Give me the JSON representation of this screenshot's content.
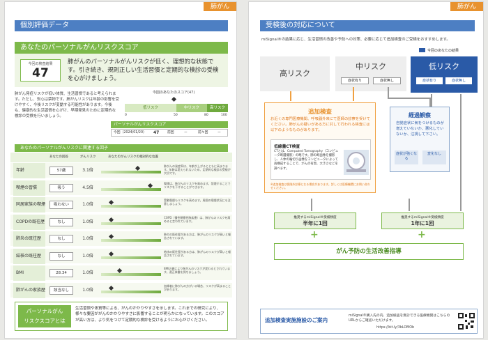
{
  "left": {
    "tab": "肺がん",
    "header": "個別評価データ",
    "score_section_title": "あなたのパーソナルがんリスクスコア",
    "score_label": "今回の検査結果",
    "score_value": "47",
    "score_message": "肺がんのパーソナルがんリスクが低く、理想的な状態です。引き続き、規則正しい生活習慣と定期的な検診の受検を心がけましょう。",
    "intro_text": "肺がん発症リスクが低い体質、生活習慣であると考えられます。ただし、安心は禁物です。肺がんリスクは年齢の影響を受けやすく、今後リスクが変動する可能性があります。今後も、健康的な生活習慣を心がけ、早期発見のために定期的な検診の受検を行いましょう。",
    "scale": {
      "caption": "今回のあなたのスコア(47)",
      "zones": [
        "低リスク",
        "中リスク",
        "高リスク"
      ],
      "ticks": [
        "0",
        "50",
        "80",
        "100"
      ],
      "score": 47
    },
    "history": {
      "title": "パーソナルがんリスクスコア",
      "now_label": "今回（2024/01/20）",
      "now_value": "47",
      "prev1_label": "前回",
      "prev1_value": "ー",
      "prev2_label": "前々回",
      "prev2_value": "ー"
    },
    "factors": {
      "title": "あなたのパーソナルがんリスクに関連する因子",
      "col_result": "あなたの回答",
      "col_mult": "がんリスク",
      "col_graph": "あなたのがんリスクの相対的な位置",
      "rows": [
        {
          "label": "年齢",
          "value": "57歳",
          "mult": "3.1倍",
          "pos": 0.62,
          "note": "肺がんの発症率は、年齢が上がるとともに高まります。年齢は変えられないため、定期的な検診の受検が大切です。"
        },
        {
          "label": "喫煙の習慣",
          "value": "吸う",
          "mult": "4.5倍",
          "pos": 0.85,
          "note": "喫煙は、肺がんのリスクを高めます。禁煙することでリスクを下げることができます。"
        },
        {
          "label": "同居家族の喫煙",
          "value": "吸わない",
          "mult": "1.0倍",
          "pos": 0.15,
          "note": "受動喫煙もリスクを高めます。周囲の喫煙状況にも注意しましょう。"
        },
        {
          "label": "COPDの既往歴",
          "value": "なし",
          "mult": "1.0倍",
          "pos": 0.15,
          "note": "COPD（慢性閉塞性肺疾患）は、肺がんのリスクを高めると言われています。"
        },
        {
          "label": "肺炎の既往歴",
          "value": "なし",
          "mult": "1.0倍",
          "pos": 0.15,
          "note": "肺炎の既往歴がある方は、肺がんのリスクが高いと報告されています。"
        },
        {
          "label": "結核の既往歴",
          "value": "なし",
          "mult": "1.0倍",
          "pos": 0.15,
          "note": "結核の既往歴がある方は、肺がんのリスクが高いと報告されています。"
        },
        {
          "label": "BMI",
          "value": "28.34",
          "mult": "1.0倍",
          "pos": 0.3,
          "note": "BMIの値により肺がんのリスクが変わるとされています。適正体重を保ちましょう。"
        },
        {
          "label": "肺がんの家族歴",
          "value": "該当なし",
          "mult": "1.0倍",
          "pos": 0.15,
          "note": "血縁者に肺がんの方がいる場合、リスクが高まることがあります。"
        }
      ]
    },
    "footer_title": "パーソナルがん\nリスクスコアとは",
    "footer_text": "生活習慣や体質等による、がんのかかりやすさを示します。これまでの研究により、様々な要因ががんのかかりやすさに影響することが明らかになっています。このスコアが高い方は、より気をつけて定期的な検診を受けるようにお心がけください。"
  },
  "right": {
    "tab": "肺がん",
    "header": "受検後の対応について",
    "intro": "miSignal®の結果に応じ、生活習慣の改善や予防への対策、必要に応じて追加検査のご受検をおすすめします。",
    "legend": "今回のあなたの結果",
    "high": {
      "label": "高リスク"
    },
    "mid": {
      "label": "中リスク",
      "sub1": "症状有り",
      "sub2": "症状無し"
    },
    "low": {
      "label": "低リスク",
      "sub1": "症状有り",
      "sub2": "症状無し"
    },
    "add_exam": {
      "title": "追加検査",
      "text": "お近くの専門医療機関、呼吸器外来にて医師の診察を受けてください。肺がんの疑いがある方に対して行われる検査には以下のようなものがあります。",
      "ct_title": "低線量CT検査",
      "ct_text": "CTとは、Computed Tomography（コンピュータ断層撮影）の略です。肺の断面像を撮影し、人体の輪切り画像をコンピュータによって再構成することで、がんの有無、大きさなどを調べます。",
      "note": "※追加検査は保険外診療となる場合があります。詳しくは医療機関にお問い合わせください。"
    },
    "follow": {
      "title": "経過観察",
      "text": "自覚症状に気をつけるものが増えていないか、悪化していないか、注視して下さい。",
      "opt1": "症状が強くなる",
      "opt2": "変化なし"
    },
    "recheck_half": {
      "label": "推奨するmiSignal®受検頻度",
      "value": "半年に1回"
    },
    "recheck_year": {
      "label": "推奨するmiSignal®受検頻度",
      "value": "1年に1回"
    },
    "plus": "+",
    "guidance": "がん予防の生活改善指導",
    "footer_title": "追加検査実施施設のご案内",
    "footer_text": "miSignal®購入先の内、追加検査を受診できる医療機関はこちらのURLからご確認いただけます。",
    "footer_url": "https://bit.ly/3bLOMOb"
  },
  "colors": {
    "accent_blue": "#4d7fc3",
    "accent_green": "#7db94a",
    "accent_orange": "#e8922e",
    "highlight_blue": "#2a5aa7"
  }
}
